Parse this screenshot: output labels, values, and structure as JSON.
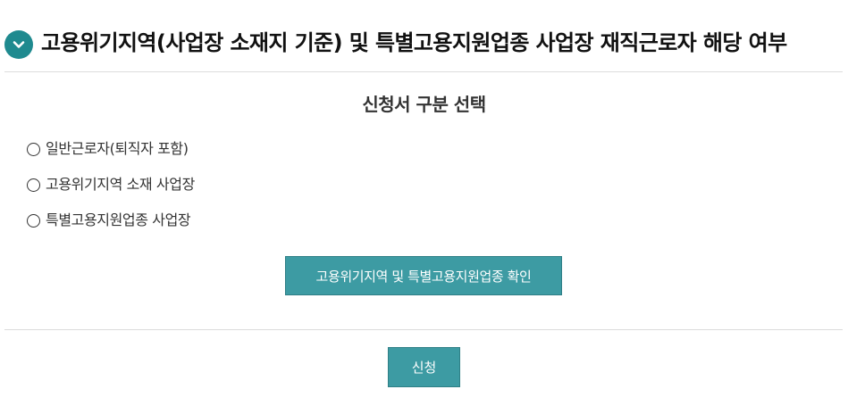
{
  "header": {
    "title": "고용위기지역(사업장 소재지 기준) 및 특별고용지원업종 사업장 재직근로자 해당 여부",
    "toggle_icon": "chevron-down-icon",
    "accent_color": "#1f8a8f"
  },
  "section": {
    "title": "신청서 구분 선택"
  },
  "options": [
    {
      "label": "일반근로자(퇴직자 포함)",
      "selected": false
    },
    {
      "label": "고용위기지역 소재 사업장",
      "selected": false
    },
    {
      "label": "특별고용지원업종 사업장",
      "selected": false
    }
  ],
  "buttons": {
    "confirm_label": "고용위기지역 및 특별고용지원업종 확인",
    "apply_label": "신청",
    "button_color": "#3d9ba3"
  }
}
